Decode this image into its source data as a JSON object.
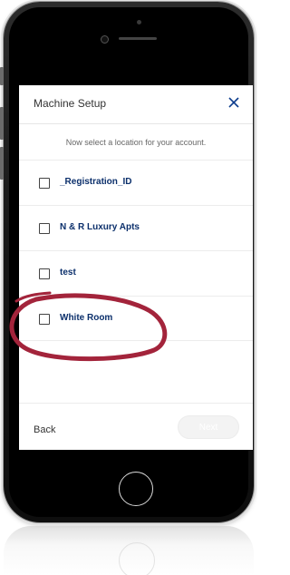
{
  "header": {
    "title": "Machine Setup",
    "close_icon": "close-icon"
  },
  "prompt": "Now select a location for your account.",
  "locations": [
    {
      "label": "_Registration_ID",
      "checked": false
    },
    {
      "label": "N & R Luxury Apts",
      "checked": false
    },
    {
      "label": "test",
      "checked": false
    },
    {
      "label": "White Room",
      "checked": false
    }
  ],
  "footer": {
    "back_label": "Back",
    "next_label": "Next"
  },
  "colors": {
    "accent": "#0b2f6b",
    "annotation": "#a3243b"
  }
}
